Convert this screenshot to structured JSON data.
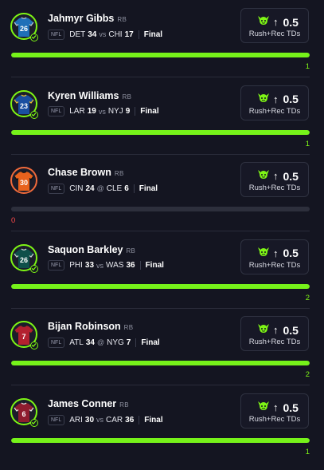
{
  "colors": {
    "background": "#141521",
    "progress_green": "#76f21a",
    "progress_track": "#2d2f3c",
    "miss_red": "#ff4a4a",
    "ring_green": "#7ef515",
    "ring_orange": "#f06a3b"
  },
  "picks": [
    {
      "player": "Jahmyr Gibbs",
      "position": "RB",
      "jersey_number": "26",
      "jersey_color": "#1f6fb8",
      "jersey_trim": "#b8c4d0",
      "league": "NFL",
      "team1": "DET",
      "score1": "34",
      "separator": "vs",
      "team2": "CHI",
      "score2": "17",
      "status": "Final",
      "pick_icon": "goblin-icon",
      "direction_icon": "arrow-up-icon",
      "line": "0.5",
      "stat": "Rush+Rec TDs",
      "progress_fraction": 1.0,
      "result_value": "1",
      "result": "hit"
    },
    {
      "player": "Kyren Williams",
      "position": "RB",
      "jersey_number": "23",
      "jersey_color": "#1a4fa0",
      "jersey_trim": "#f1c232",
      "league": "NFL",
      "team1": "LAR",
      "score1": "19",
      "separator": "vs",
      "team2": "NYJ",
      "score2": "9",
      "status": "Final",
      "pick_icon": "goblin-icon",
      "direction_icon": "arrow-up-icon",
      "line": "0.5",
      "stat": "Rush+Rec TDs",
      "progress_fraction": 1.0,
      "result_value": "1",
      "result": "hit"
    },
    {
      "player": "Chase Brown",
      "position": "RB",
      "jersey_number": "30",
      "jersey_color": "#e8621d",
      "jersey_trim": "#111111",
      "league": "NFL",
      "team1": "CIN",
      "score1": "24",
      "separator": "@",
      "team2": "CLE",
      "score2": "6",
      "status": "Final",
      "pick_icon": "goblin-icon",
      "direction_icon": "arrow-up-icon",
      "line": "0.5",
      "stat": "Rush+Rec TDs",
      "progress_fraction": 0.0,
      "result_value": "0",
      "result": "miss"
    },
    {
      "player": "Saquon Barkley",
      "position": "RB",
      "jersey_number": "26",
      "jersey_color": "#0f4f4a",
      "jersey_trim": "#c9d3d2",
      "league": "NFL",
      "team1": "PHI",
      "score1": "33",
      "separator": "vs",
      "team2": "WAS",
      "score2": "36",
      "status": "Final",
      "pick_icon": "goblin-icon",
      "direction_icon": "arrow-up-icon",
      "line": "0.5",
      "stat": "Rush+Rec TDs",
      "progress_fraction": 1.0,
      "result_value": "2",
      "result": "hit"
    },
    {
      "player": "Bijan Robinson",
      "position": "RB",
      "jersey_number": "7",
      "jersey_color": "#b3202f",
      "jersey_trim": "#222222",
      "league": "NFL",
      "team1": "ATL",
      "score1": "34",
      "separator": "@",
      "team2": "NYG",
      "score2": "7",
      "status": "Final",
      "pick_icon": "goblin-icon",
      "direction_icon": "arrow-up-icon",
      "line": "0.5",
      "stat": "Rush+Rec TDs",
      "progress_fraction": 1.0,
      "result_value": "2",
      "result": "hit"
    },
    {
      "player": "James Conner",
      "position": "RB",
      "jersey_number": "6",
      "jersey_color": "#8e1c2e",
      "jersey_trim": "#e8e8e8",
      "league": "NFL",
      "team1": "ARI",
      "score1": "30",
      "separator": "vs",
      "team2": "CAR",
      "score2": "36",
      "status": "Final",
      "pick_icon": "goblin-icon",
      "direction_icon": "arrow-up-icon",
      "line": "0.5",
      "stat": "Rush+Rec TDs",
      "progress_fraction": 1.0,
      "result_value": "1",
      "result": "hit"
    }
  ]
}
